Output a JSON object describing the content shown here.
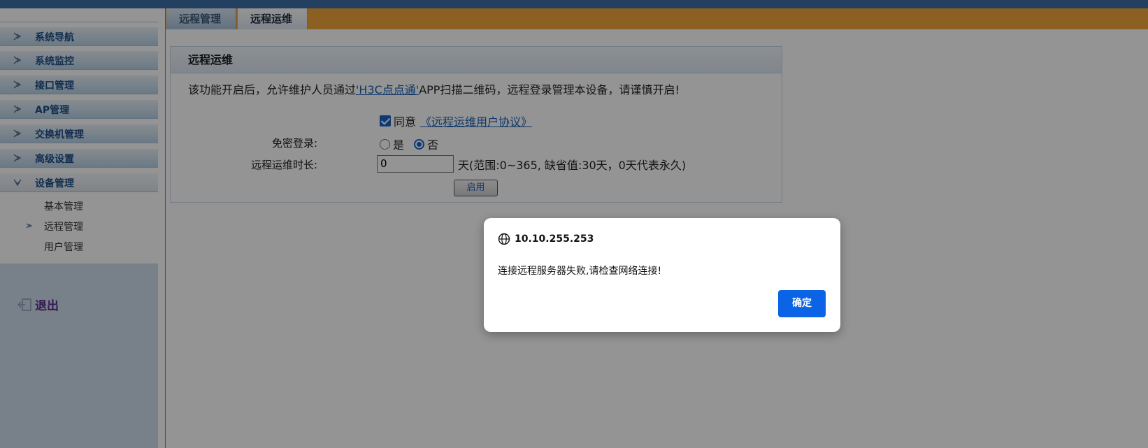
{
  "sidebar": {
    "items": [
      {
        "label": "系统导航"
      },
      {
        "label": "系统监控"
      },
      {
        "label": "接口管理"
      },
      {
        "label": "AP管理"
      },
      {
        "label": "交换机管理"
      },
      {
        "label": "高级设置"
      },
      {
        "label": "设备管理"
      }
    ],
    "sub_items": [
      {
        "label": "基本管理"
      },
      {
        "label": "远程管理"
      },
      {
        "label": "用户管理"
      }
    ],
    "logout_label": "退出"
  },
  "tabs": [
    {
      "label": "远程管理"
    },
    {
      "label": "远程运维"
    }
  ],
  "panel": {
    "title": "远程运维",
    "desc_prefix": "该功能开启后，允许维护人员通过",
    "desc_link": "'H3C点点通'",
    "desc_suffix": "APP扫描二维码，远程登录管理本设备，请谨慎开启!",
    "agree_label": "同意",
    "agree_link": "《远程运维用户协议》",
    "nopass_label": "免密登录:",
    "radio_yes": "是",
    "radio_no": "否",
    "duration_label": "远程运维时长:",
    "duration_value": "0",
    "duration_hint": "天(范围:0~365, 缺省值:30天，0天代表永久)",
    "enable_label": "启用"
  },
  "dialog": {
    "host": "10.10.255.253",
    "message": "连接远程服务器失败,请检查网络连接!",
    "ok_label": "确定"
  }
}
